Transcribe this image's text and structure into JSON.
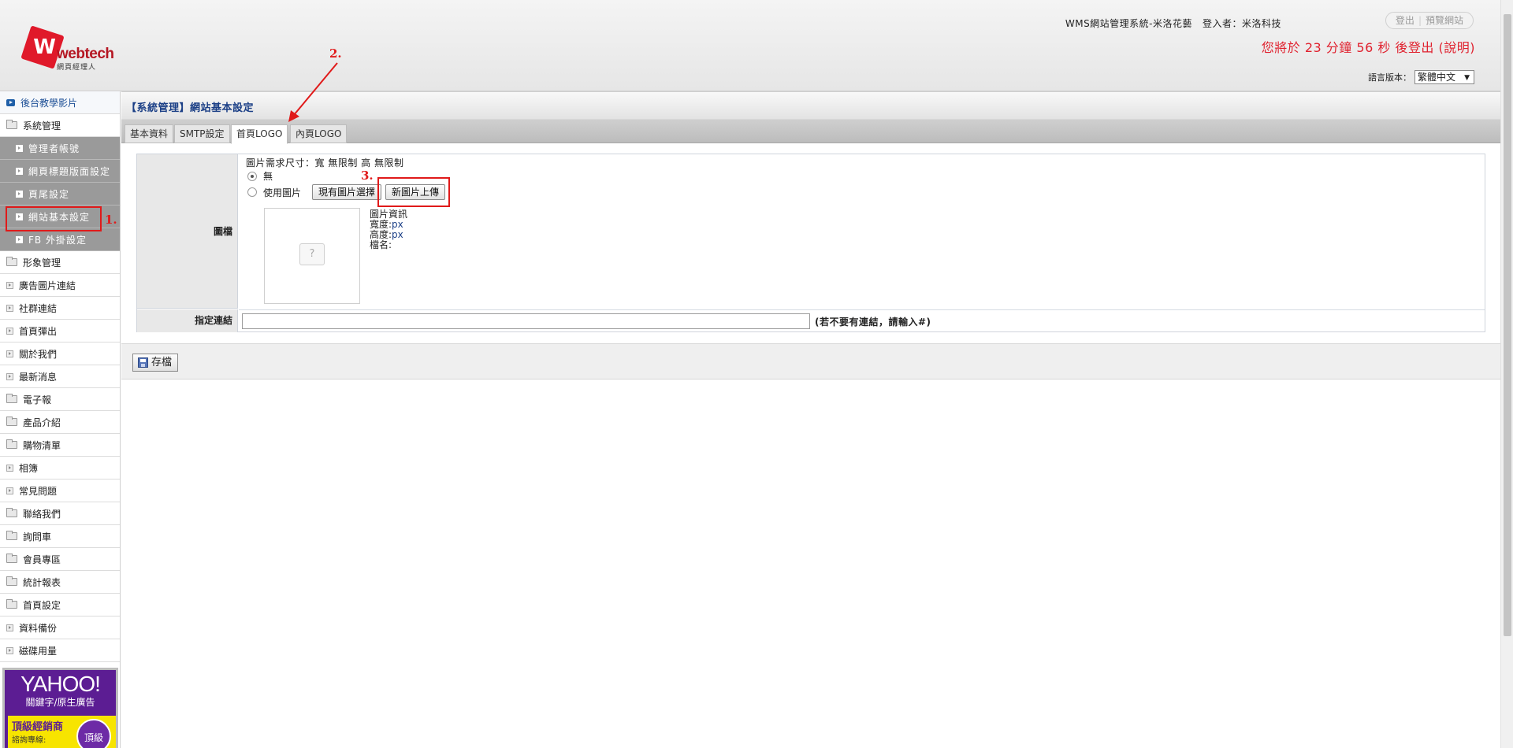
{
  "header": {
    "logo_word": "webtech",
    "logo_sub": "網頁經理人",
    "system_title": "WMS網站管理系統-米洛花藝",
    "login_label": "登入者：",
    "login_user": "米洛科技",
    "logout_label": "登出",
    "preview_label": "預覽網站",
    "countdown": "您將於 23 分鐘 56 秒 後登出 (說明)",
    "lang_label": "語言版本：",
    "lang_value": "繁體中文"
  },
  "sidebar": {
    "items": [
      {
        "label": "後台教學影片",
        "icon": "play-icon"
      },
      {
        "label": "系統管理",
        "icon": "folder-icon"
      },
      {
        "label": "管理者帳號",
        "sub": true
      },
      {
        "label": "網頁標題版面設定",
        "sub": true
      },
      {
        "label": "頁尾設定",
        "sub": true
      },
      {
        "label": "網站基本設定",
        "sub": true,
        "active": true
      },
      {
        "label": "FB 外掛設定",
        "sub": true
      },
      {
        "label": "形象管理",
        "icon": "folder-icon"
      },
      {
        "label": "廣告圖片連結",
        "icon": "page-icon"
      },
      {
        "label": "社群連結",
        "icon": "page-icon"
      },
      {
        "label": "首頁彈出",
        "icon": "page-icon"
      },
      {
        "label": "關於我們",
        "icon": "page-icon"
      },
      {
        "label": "最新消息",
        "icon": "page-icon"
      },
      {
        "label": "電子報",
        "icon": "folder-icon"
      },
      {
        "label": "產品介紹",
        "icon": "folder-icon"
      },
      {
        "label": "購物清單",
        "icon": "folder-icon"
      },
      {
        "label": "相簿",
        "icon": "page-icon"
      },
      {
        "label": "常見問題",
        "icon": "page-icon"
      },
      {
        "label": "聯絡我們",
        "icon": "folder-icon"
      },
      {
        "label": "詢問車",
        "icon": "folder-icon"
      },
      {
        "label": "會員專區",
        "icon": "folder-icon"
      },
      {
        "label": "統計報表",
        "icon": "folder-icon"
      },
      {
        "label": "首頁設定",
        "icon": "folder-icon"
      },
      {
        "label": "資料備份",
        "icon": "page-icon"
      },
      {
        "label": "磁碟用量",
        "icon": "page-icon"
      }
    ],
    "ad": {
      "brand": "YAHOO!",
      "tagline": "關鍵字/原生廣告",
      "line1": "頂級經銷商",
      "line2": "諮詢專線:",
      "badge": "頂級"
    }
  },
  "main": {
    "title": "【系統管理】網站基本設定",
    "tabs": [
      "基本資料",
      "SMTP設定",
      "首頁LOGO",
      "內頁LOGO"
    ],
    "active_tab": "首頁LOGO",
    "form": {
      "image_label": "圖檔",
      "size_info": "圖片需求尺寸：寬 無限制 高 無限制",
      "option_none": "無",
      "option_use_image": "使用圖片",
      "choose_existing_button": "現有圖片選擇",
      "upload_new_button": "新圖片上傳",
      "thumb_placeholder": "?",
      "info_title": "圖片資訊",
      "width_label": "寬度:",
      "width_unit": "px",
      "height_label": "高度:",
      "height_unit": "px",
      "filename_label": "檔名:",
      "link_label": "指定連結",
      "link_value": "",
      "link_hint": "(若不要有連結，請輸入#)"
    },
    "save_button": "存檔"
  },
  "annotations": {
    "step1": "1.",
    "step2": "2.",
    "step3": "3."
  },
  "colors": {
    "annotation": "#e01a1a",
    "countdown": "#e0212e",
    "title_blue": "#1b3f86"
  }
}
